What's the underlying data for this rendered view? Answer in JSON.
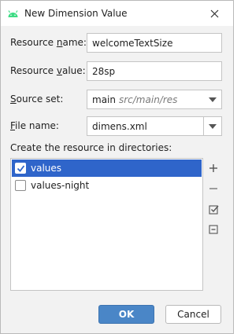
{
  "window": {
    "title": "New Dimension Value",
    "icon": "android-icon",
    "close_icon": "close-icon"
  },
  "form": {
    "resource_name": {
      "label_pre": "Resource ",
      "label_u": "n",
      "label_post": "ame:",
      "value": "welcomeTextSize"
    },
    "resource_value": {
      "label_pre": "Resource ",
      "label_u": "v",
      "label_post": "alue:",
      "value": "28sp"
    },
    "source_set": {
      "label_pre": "",
      "label_u": "S",
      "label_post": "ource set:",
      "value": "main",
      "path": "src/main/res"
    },
    "file_name": {
      "label_pre": "",
      "label_u": "F",
      "label_post": "ile name:",
      "value": "dimens.xml"
    }
  },
  "directories": {
    "label": "Create the resource in directories:",
    "items": [
      {
        "label": "values",
        "checked": true,
        "selected": true
      },
      {
        "label": "values-night",
        "checked": false,
        "selected": false
      }
    ]
  },
  "side_tools": [
    "plus-icon",
    "minus-icon",
    "check-all-icon",
    "collapse-icon"
  ],
  "buttons": {
    "ok": "OK",
    "cancel": "Cancel"
  },
  "colors": {
    "selection": "#2f65ca",
    "ok_button": "#4a86c7",
    "android_green": "#3ddc84"
  }
}
